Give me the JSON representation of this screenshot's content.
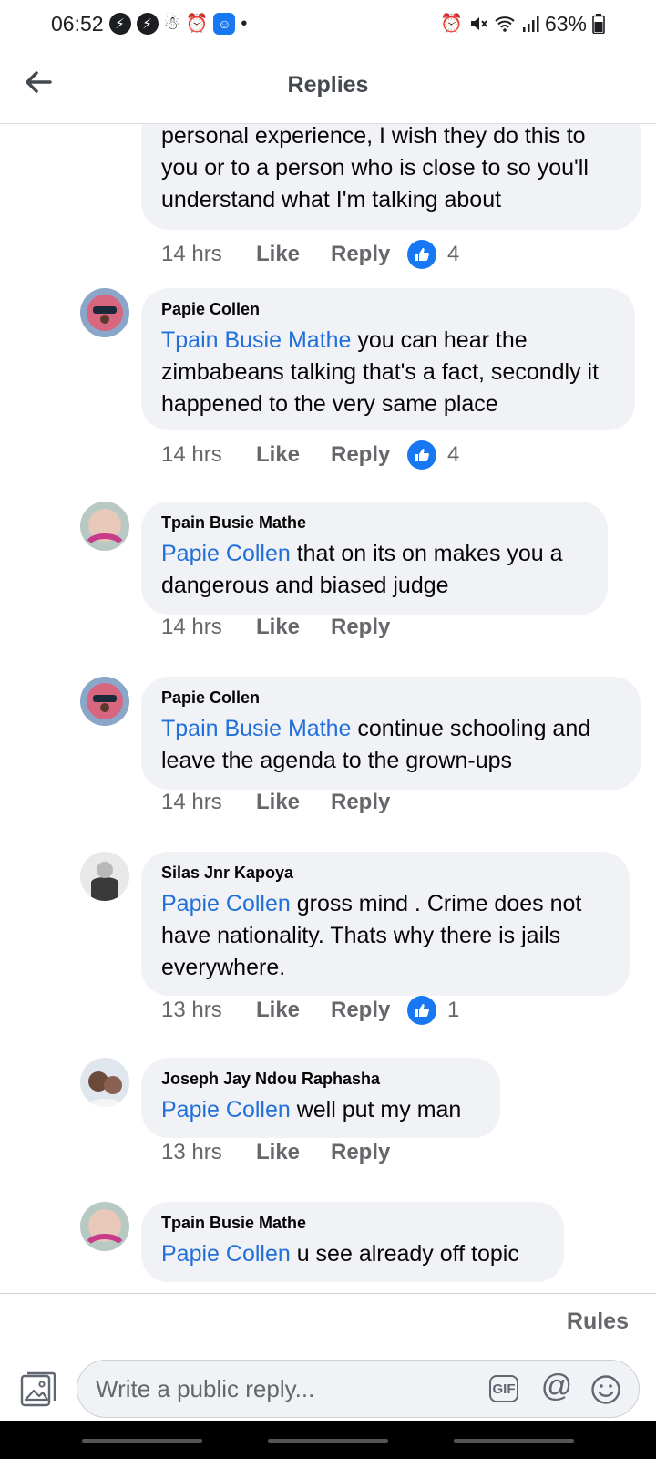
{
  "status_bar": {
    "time": "06:52",
    "battery": "63%",
    "left_icons": [
      "messenger-icon",
      "messenger-icon",
      "person-icon",
      "alarm-icon",
      "app-icon",
      "dot-icon"
    ],
    "right_icons": [
      "alarm-icon",
      "mute-icon",
      "wifi-icon",
      "signal-icon",
      "battery-icon"
    ]
  },
  "header": {
    "title": "Replies",
    "back_icon": "arrow-left-icon"
  },
  "comments": [
    {
      "text": "personal experience, I wish they do this to you or to a person who is close to so you'll understand what I'm talking about",
      "time": "14 hrs",
      "like": "Like",
      "reply": "Reply",
      "reactions": "4"
    },
    {
      "author": "Papie Collen",
      "mention": "Tpain Busie Mathe",
      "text": " you can hear the zimbabeans talking that's a fact, secondly it happened to the very same place",
      "time": "14 hrs",
      "like": "Like",
      "reply": "Reply",
      "reactions": "4"
    },
    {
      "author": "Tpain Busie Mathe",
      "mention": "Papie Collen",
      "text": " that on its on makes you a dangerous and biased judge",
      "time": "14 hrs",
      "like": "Like",
      "reply": "Reply"
    },
    {
      "author": "Papie Collen",
      "mention": "Tpain Busie Mathe",
      "text": " continue schooling and leave the agenda to the grown-ups",
      "time": "14 hrs",
      "like": "Like",
      "reply": "Reply"
    },
    {
      "author": "Silas Jnr Kapoya",
      "mention": "Papie Collen",
      "text": " gross mind . Crime does not have nationality.  Thats why there is jails everywhere.",
      "time": "13 hrs",
      "like": "Like",
      "reply": "Reply",
      "reactions": "1"
    },
    {
      "author": "Joseph Jay Ndou Raphasha",
      "mention": "Papie Collen",
      "text": " well put my man",
      "time": "13 hrs",
      "like": "Like",
      "reply": "Reply"
    },
    {
      "author": "Tpain Busie Mathe",
      "mention": "Papie Collen",
      "text": " u see already off topic"
    }
  ],
  "footer": {
    "rules": "Rules",
    "placeholder": "Write a public reply...",
    "gif": "GIF",
    "at": "@"
  },
  "colors": {
    "accent": "#1877f2",
    "mention": "#216fdb",
    "bubble": "#f0f2f5",
    "meta": "#65676b"
  }
}
